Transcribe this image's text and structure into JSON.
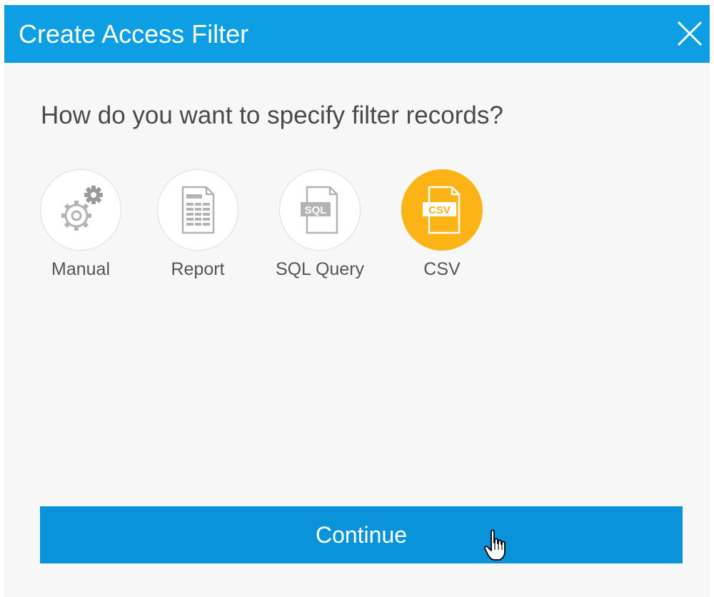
{
  "dialog": {
    "title": "Create Access Filter",
    "close_icon": "close-icon",
    "question": "How do you want to specify filter records?",
    "options": [
      {
        "label": "Manual",
        "icon": "gears-icon",
        "selected": false
      },
      {
        "label": "Report",
        "icon": "report-document-icon",
        "selected": false
      },
      {
        "label": "SQL Query",
        "icon": "sql-document-icon",
        "selected": false
      },
      {
        "label": "CSV",
        "icon": "csv-document-icon",
        "selected": true
      }
    ],
    "continue_label": "Continue",
    "sql_badge": "SQL",
    "csv_badge": "CSV"
  },
  "colors": {
    "header": "#0d9ee4",
    "button": "#0a93d9",
    "selected": "#fbb316",
    "background": "#f7f7f7"
  }
}
